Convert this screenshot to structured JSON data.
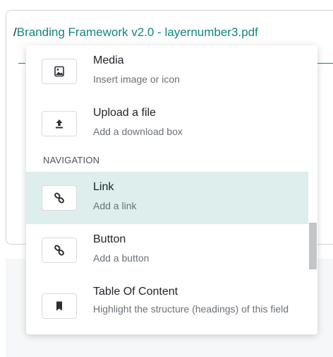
{
  "path": {
    "prefix": "/",
    "file_link": "Branding Framework v2.0 - layernumber3.pdf"
  },
  "menu": {
    "items_top": [
      {
        "title": "Media",
        "description": "Insert image or icon",
        "icon": "image-icon"
      },
      {
        "title": "Upload a file",
        "description": "Add a download box",
        "icon": "upload-icon"
      }
    ],
    "section_navigation": "NAVIGATION",
    "items_nav": [
      {
        "title": "Link",
        "description": "Add a link",
        "icon": "link-icon",
        "active": true
      },
      {
        "title": "Button",
        "description": "Add a button",
        "icon": "link-icon"
      },
      {
        "title": "Table Of Content",
        "description": "Highlight the structure (headings) of this field",
        "icon": "bookmark-icon"
      }
    ]
  },
  "colors": {
    "accent": "#13857f",
    "active_row": "#ddeeed",
    "scroll_thumb": "#c3c6c9"
  }
}
